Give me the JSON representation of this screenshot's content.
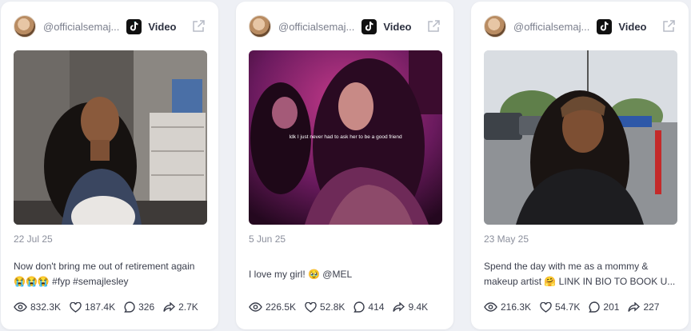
{
  "cards": [
    {
      "handle": "@officialsemaj...",
      "type_label": "Video",
      "date": "22 Jul 25",
      "caption": "Now don't bring me out of retirement again 😭😭😭 #fyp #semajlesley",
      "stats": {
        "views": "832.3K",
        "likes": "187.4K",
        "comments": "326",
        "shares": "2.7K"
      }
    },
    {
      "handle": "@officialsemaj...",
      "type_label": "Video",
      "date": "5 Jun 25",
      "caption": "I love my girl! 🥹 @MEL",
      "overlay_text": "Idk I just never had to ask her to be a good friend",
      "stats": {
        "views": "226.5K",
        "likes": "52.8K",
        "comments": "414",
        "shares": "9.4K"
      }
    },
    {
      "handle": "@officialsemaj...",
      "type_label": "Video",
      "date": "23 May 25",
      "caption": "Spend the day with me as a mommy & makeup artist 🤗 LINK IN BIO TO BOOK U...",
      "stats": {
        "views": "216.3K",
        "likes": "54.7K",
        "comments": "201",
        "shares": "227"
      }
    }
  ],
  "icons": {
    "platform": "tiktok-icon",
    "open": "external-link-icon",
    "views": "eye-icon",
    "likes": "heart-icon",
    "comments": "comment-icon",
    "shares": "share-icon"
  },
  "colors": {
    "background": "#eef0f5",
    "card": "#ffffff",
    "text": "#3a3e4c",
    "muted": "#8b8f9c"
  }
}
